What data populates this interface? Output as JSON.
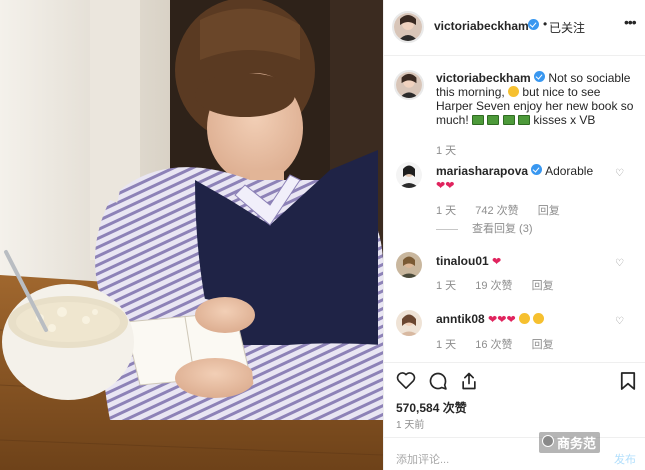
{
  "post": {
    "author": "victoriabeckham",
    "follow_label": "已关注",
    "dot": "•",
    "more_label": "•••"
  },
  "caption": {
    "author": "victoriabeckham",
    "text_1": "Not so sociable this morning,",
    "text_2": "but nice to see Harper Seven enjoy her new book so much!",
    "text_3": "kisses x VB",
    "time": "1 天"
  },
  "comments": [
    {
      "author": "mariasharapova",
      "text": "Adorable",
      "time": "1 天",
      "likes": "742 次赞",
      "reply": "回复",
      "view_replies": "查看回复 (3)"
    },
    {
      "author": "tinalou01",
      "time": "1 天",
      "likes": "19 次赞",
      "reply": "回复"
    },
    {
      "author": "anntik08",
      "time": "1 天",
      "likes": "16 次赞",
      "reply": "回复"
    }
  ],
  "stats": {
    "likes": "570,584 次赞",
    "posted": "1 天前"
  },
  "add_comment": {
    "placeholder": "添加评论...",
    "post_label": "发布"
  },
  "watermark": {
    "label": "商务范"
  },
  "colors": {
    "verified": "#3897f0",
    "heart": "#e0245e",
    "muted_text": "#8e8e8e"
  },
  "icons": [
    "heart-icon",
    "comment-icon",
    "share-icon",
    "bookmark-icon",
    "more-icon",
    "verified-icon"
  ]
}
